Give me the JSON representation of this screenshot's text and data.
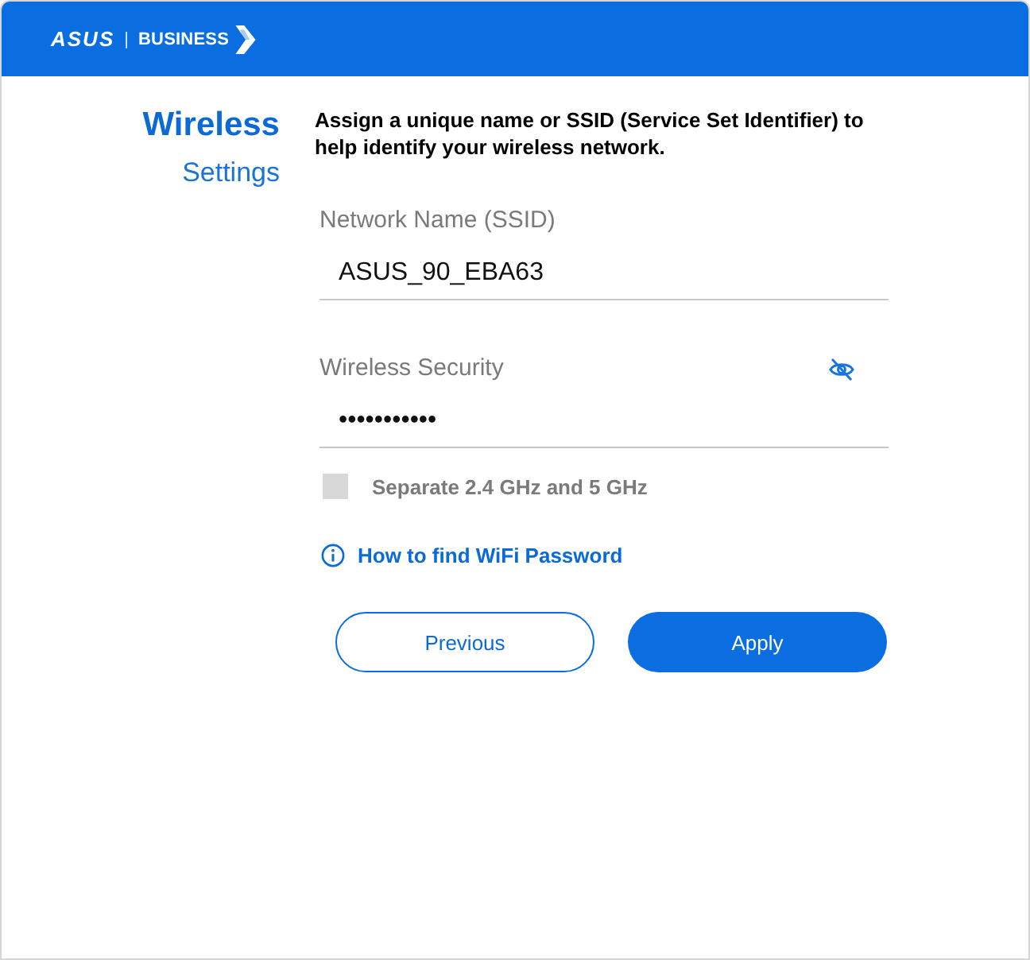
{
  "header": {
    "brand": "ASUS",
    "separator": "|",
    "product_line": "BUSINESS"
  },
  "page_title": {
    "heading": "Wireless",
    "subheading": "Settings"
  },
  "intro": "Assign a unique name or SSID (Service Set Identifier) to help identify your wireless network.",
  "fields": [
    {
      "kind": "text",
      "label": "Network Name (SSID)",
      "value": "ASUS_90_EBA63"
    },
    {
      "kind": "password",
      "label": "Wireless Security",
      "value": "•••••••••••"
    }
  ],
  "checkbox": {
    "label": "Separate 2.4 GHz and 5 GHz",
    "checked": false
  },
  "help_link": {
    "text": "How to find WiFi Password"
  },
  "buttons": [
    {
      "kind": "secondary",
      "label": "Previous"
    },
    {
      "kind": "primary",
      "label": "Apply"
    }
  ]
}
